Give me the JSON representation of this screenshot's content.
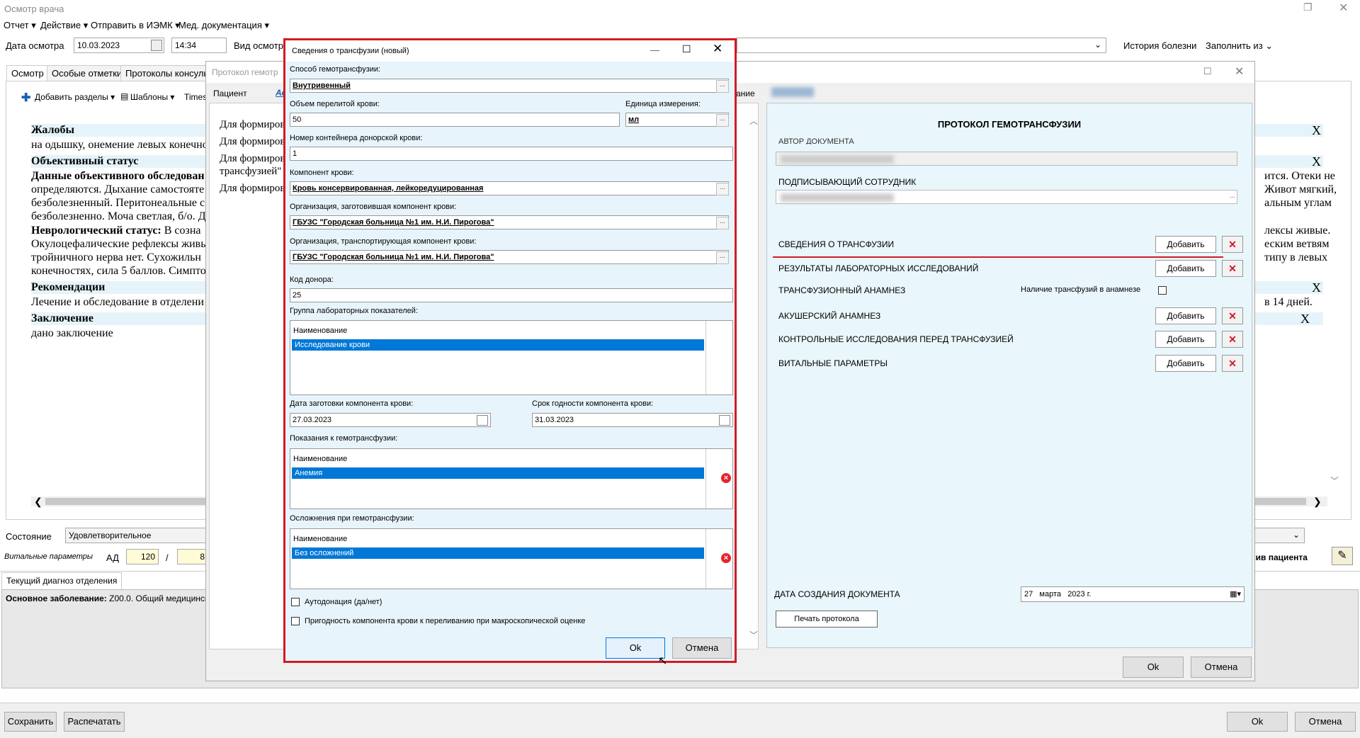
{
  "window_title": "Осмотр врача",
  "menu": [
    "Отчет",
    "Действие",
    "Отправить в ИЭМК",
    "Мед. документация"
  ],
  "top": {
    "date_label": "Дата осмотра",
    "date": "10.03.2023",
    "time": "14:34",
    "kind_label": "Вид осмотра",
    "history": "История болезни",
    "fill": "Заполнить из"
  },
  "tabs": [
    "Осмотр",
    "Особые отметки",
    "Протоколы консульт"
  ],
  "toolbar": {
    "add": "Добавить разделы",
    "templates": "Шаблоны",
    "font": "Times"
  },
  "doc": {
    "h1": "Жалобы",
    "l1": "на одышку, онемение левых конечнос",
    "h2": "Объективный статус",
    "h3": "Данные объективного обследован",
    "l3": "определяются. Дыхание самостояте",
    "l4": "безболезненный. Перитонеальные с",
    "l5": "безболезненно. Моча светлая, б/о. Д",
    "h4": "Неврологический статус:",
    "l6": "В созна",
    "l7": "Окулоцефалические рефлексы живы",
    "l8": "тройничного нерва нет. Сухожильн",
    "l9": "конечностях, сила 5 баллов. Симпто",
    "h5": "Рекомендации",
    "l10": "Лечение и обследование в отделени",
    "h6": "Заключение",
    "l11": "дано заключение",
    "r1": "ится. Отеки не",
    "r2": "Живот мягкий,",
    "r3": "альным углам",
    "r4": "лексы живые.",
    "r5": "еским ветвям",
    "r6": "типу в левых",
    "r7": "в 14 дней.",
    "x": "X"
  },
  "bottom": {
    "state_label": "Состояние",
    "state": "Удовлетворительное",
    "vital_label": "Витальные параметры",
    "ad_label": "АД",
    "ad1": "120",
    "ad2": "8",
    "slash": "/",
    "diag_tab": "Текущий диагноз отделения",
    "diag": "Основное заболевание:",
    "diag_text": "Z00.0. Общий медицинск",
    "archive": "хив пациента",
    "save": "Сохранить",
    "print": "Распечатать",
    "ok": "Ok",
    "cancel": "Отмена"
  },
  "proto": {
    "title": "Протокол гемотр",
    "patient": "Пациент",
    "ao": "Ао",
    "ie": "ание",
    "lines": [
      "Для формиров",
      "Для формиров",
      "Для формиров",
      "трансфузией\"",
      "Для формиров"
    ],
    "ok": "Ok",
    "cancel": "Отмена"
  },
  "dialog": {
    "title": "Сведения о трансфузии (новый)",
    "method_label": "Способ гемотрансфузии:",
    "method": "Внутривенный",
    "volume_label": "Объем перелитой крови:",
    "volume": "50",
    "unit_label": "Единица измерения:",
    "unit": "мл",
    "container_label": "Номер контейнера донорской крови:",
    "container": "1",
    "component_label": "Компонент крови:",
    "component": "Кровь консервированная, лейкоредуцированная",
    "org_prep_label": "Организация, заготовившая компонент крови:",
    "org_prep": "ГБУЗС \"Городская больница №1 им. Н.И. Пирогова\"",
    "org_trans_label": "Организация, транспортирующая компонент крови:",
    "org_trans": "ГБУЗС \"Городская больница №1 им. Н.И. Пирогова\"",
    "donor_label": "Код донора:",
    "donor": "25",
    "lab_label": "Группа лабораторных показателей:",
    "col": "Наименование",
    "lab_item": "Исследование крови",
    "prep_date_label": "Дата заготовки компонента крови:",
    "prep_date": "27.03.2023",
    "exp_label": "Срок годности компонента крови:",
    "exp_date": "31.03.2023",
    "ind_label": "Показания к гемотрансфузии:",
    "ind_item": "Анемия",
    "comp_label": "Осложнения при гемотрансфузии:",
    "comp_item": "Без осложнений",
    "auto": "Аутодонация (да/нет)",
    "fit": "Пригодность компонента крови к переливанию при макроскопической оценке",
    "ok": "Ok",
    "cancel": "Отмена",
    "dots": "..."
  },
  "right": {
    "title": "ПРОТОКОЛ ГЕМОТРАНСФУЗИИ",
    "author": "АВТОР ДОКУМЕНТА",
    "signer": "ПОДПИСЫВАЮЩИЙ СОТРУДНИК",
    "rows": [
      "СВЕДЕНИЯ О ТРАНСФУЗИИ",
      "РЕЗУЛЬТАТЫ ЛАБОРАТОРНЫХ ИССЛЕДОВАНИЙ",
      "ТРАНСФУЗИОННЫЙ АНАМНЕЗ",
      "АКУШЕРСКИЙ АНАМНЕЗ",
      "КОНТРОЛЬНЫЕ ИССЛЕДОВАНИЯ ПЕРЕД ТРАНСФУЗИЕЙ",
      "ВИТАЛЬНЫЕ ПАРАМЕТРЫ"
    ],
    "add": "Добавить",
    "history_label": "Наличие трансфузий в анамнезе",
    "created_label": "ДАТА СОЗДАНИЯ ДОКУМЕНТА",
    "created_day": "27",
    "created_month": "марта",
    "created_year": "2023 г.",
    "print": "Печать протокола",
    "ok": "Ok",
    "cancel": "Отмена"
  },
  "colors": {
    "accent": "#d21b23",
    "select": "#0078d7",
    "panel": "#e9f6fc"
  }
}
